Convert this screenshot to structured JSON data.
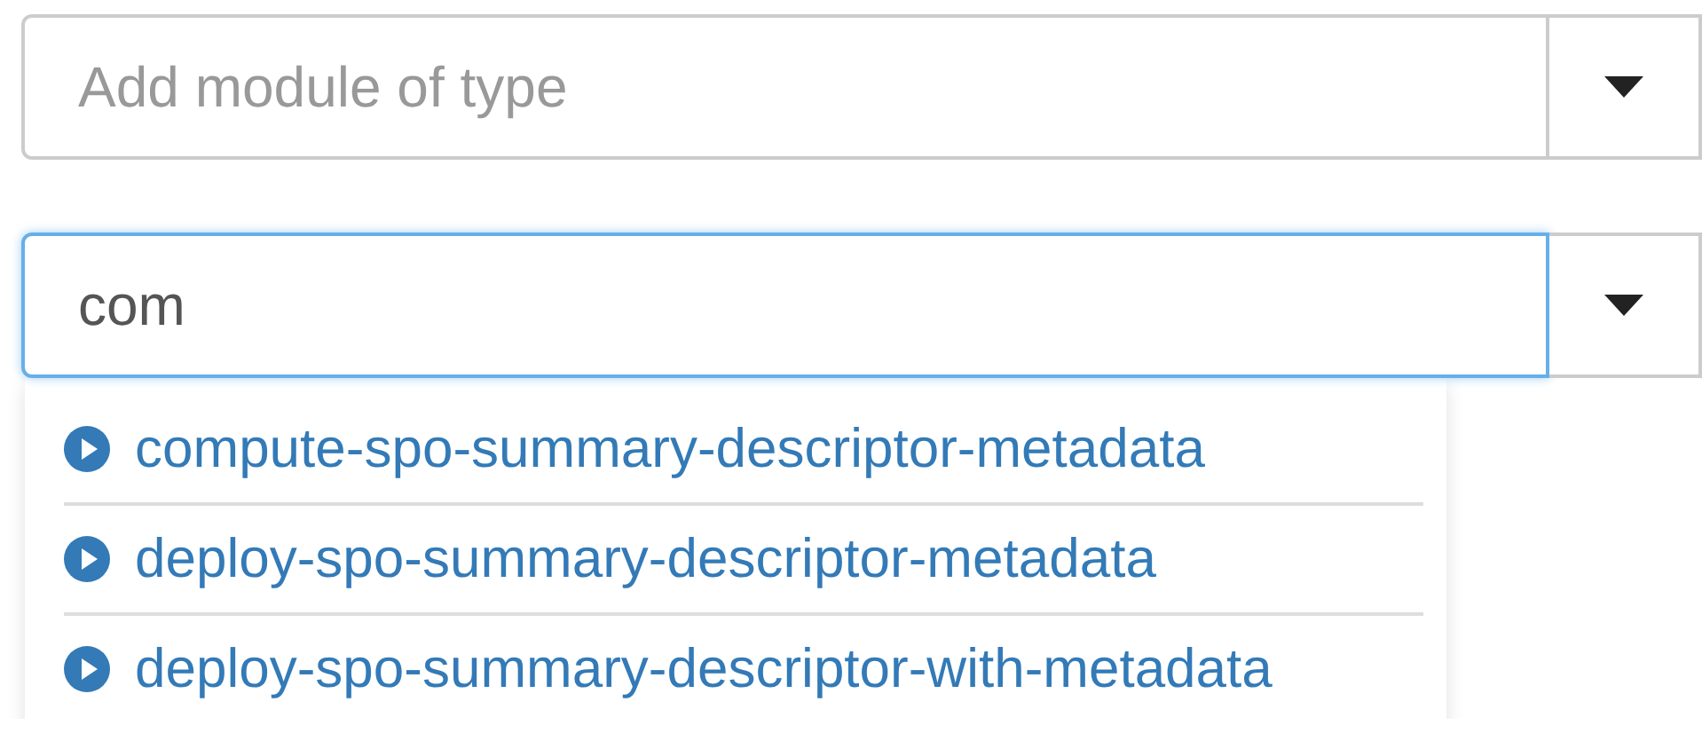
{
  "fields": [
    {
      "placeholder": "Add module of type",
      "focused": false
    },
    {
      "value": "com",
      "focused": true
    }
  ],
  "suggestions": [
    {
      "label": "compute-spo-summary-descriptor-metadata"
    },
    {
      "label": "deploy-spo-summary-descriptor-metadata"
    },
    {
      "label": "deploy-spo-summary-descriptor-with-metadata"
    }
  ]
}
